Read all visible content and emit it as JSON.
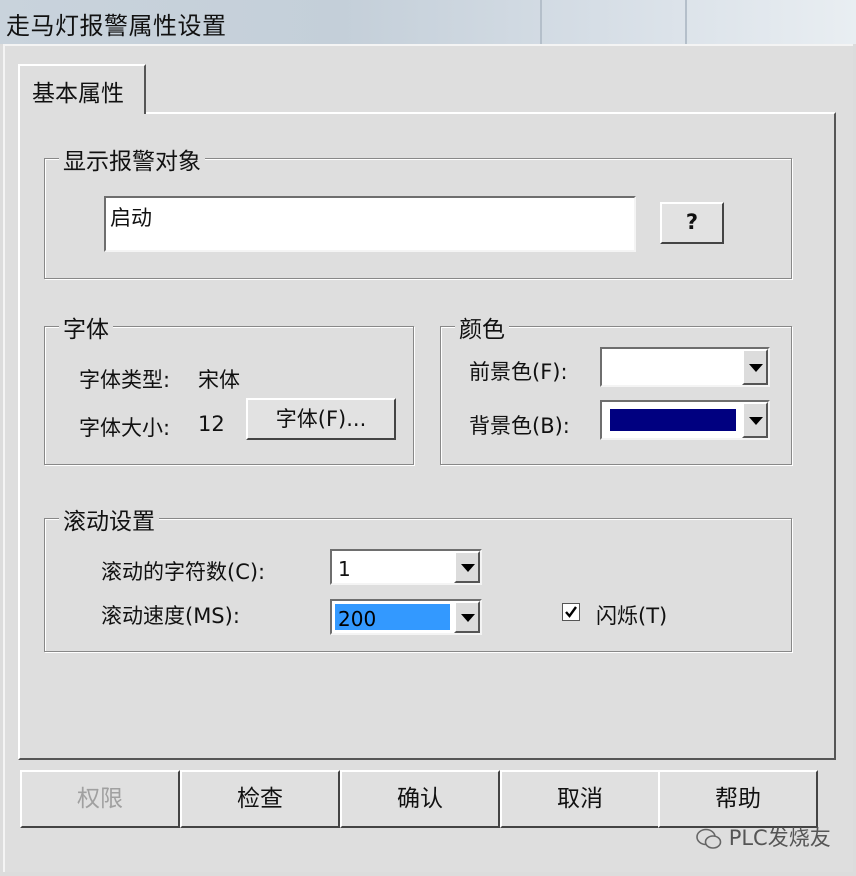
{
  "window": {
    "title": "走马灯报警属性设置"
  },
  "tabs": [
    {
      "label": "基本属性",
      "active": true
    }
  ],
  "alarm_object": {
    "group_title": "显示报警对象",
    "value": "启动",
    "browse_label": "?"
  },
  "font": {
    "group_title": "字体",
    "type_label": "字体类型:",
    "type_value": "宋体",
    "size_label": "字体大小:",
    "size_value": "12",
    "button_label": "字体(F)..."
  },
  "color": {
    "group_title": "颜色",
    "foreground_label": "前景色(F):",
    "foreground_value": "#ffffff",
    "background_label": "背景色(B):",
    "background_value": "#000080"
  },
  "scroll": {
    "group_title": "滚动设置",
    "chars_label": "滚动的字符数(C):",
    "chars_value": "1",
    "speed_label": "滚动速度(MS):",
    "speed_value": "200",
    "flash_label": "闪烁(T)",
    "flash_checked": true
  },
  "buttons": {
    "permission": "权限",
    "check": "检查",
    "confirm": "确认",
    "cancel": "取消",
    "help": "帮助"
  },
  "watermark": {
    "icon": "wechat-icon",
    "text": "PLC发烧友"
  },
  "colors": {
    "selection": "#3399ff",
    "navy": "#000080"
  }
}
